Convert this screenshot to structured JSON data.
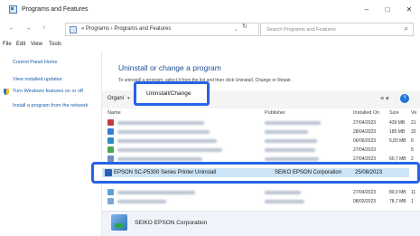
{
  "window": {
    "title": "Programs and Features",
    "minimize": "–",
    "maximize": "□",
    "close": "✕"
  },
  "address": {
    "back": "←",
    "forward": "→",
    "up": "↑",
    "path": "«  Programs  ›  Programs and Features",
    "refresh": "↻",
    "search_placeholder": "Search Programs and Features",
    "search_icon": "search-icon"
  },
  "menu": [
    "File",
    "Edit",
    "View",
    "Tools"
  ],
  "sidebar": {
    "links": [
      "Control Panel Home",
      "View installed updates",
      "Turn Windows features on or off",
      "Install a program from the network"
    ]
  },
  "main": {
    "title": "Uninstall or change a program",
    "desc": "To uninstall a program, select it from the list and then click Uninstall, Change or Repair."
  },
  "toolbar": {
    "organize": "Organi",
    "caret": "▾",
    "uninstall": "Uninstall/Change",
    "view": "≡ ▾",
    "help": "?"
  },
  "columns": {
    "name": "Name",
    "publisher": "Publisher",
    "installed": "Installed On",
    "size": "Size",
    "version": "Ve"
  },
  "rows": [
    {
      "date": "27/04/2023",
      "size": "439 MB",
      "ver": "21"
    },
    {
      "date": "28/04/2023",
      "size": "185 MB",
      "ver": "32"
    },
    {
      "date": "06/06/2023",
      "size": "5,83 MB",
      "ver": "6"
    },
    {
      "date": "27/04/2023",
      "size": "",
      "ver": "5"
    },
    {
      "date": "27/04/2023",
      "size": "60,7 MB",
      "ver": "2"
    }
  ],
  "selected": {
    "name": "EPSON SC-P5300 Series Printer Uninstall",
    "publisher": "SEIKO EPSON Corporation",
    "date": "25/08/2023"
  },
  "rows_after": [
    {
      "date": "27/04/2023",
      "size": "80,0 MB",
      "ver": "11"
    },
    {
      "date": "08/03/2023",
      "size": "78,7 MB",
      "ver": "1"
    }
  ],
  "details": {
    "name": "SEIKO EPSON Corporation"
  }
}
